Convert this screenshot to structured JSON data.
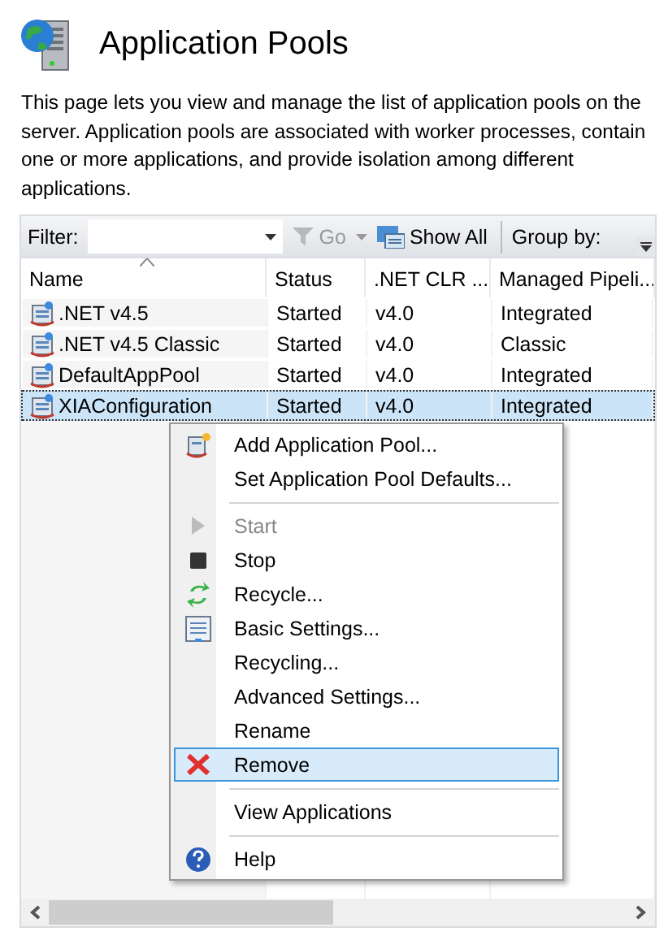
{
  "header": {
    "title": "Application Pools",
    "description": "This page lets you view and manage the list of application pools on the server. Application pools are associated with worker processes, contain one or more applications, and provide isolation among different applications."
  },
  "toolbar": {
    "filter_label": "Filter:",
    "go": {
      "label": "Go",
      "disabled": true
    },
    "show_all": "Show All",
    "group_by": "Group by:"
  },
  "table": {
    "columns": [
      {
        "label": "Name",
        "sorted": true
      },
      {
        "label": "Status",
        "sorted": false
      },
      {
        "label": ".NET CLR ...",
        "sorted": false
      },
      {
        "label": "Managed Pipeli...",
        "sorted": false
      }
    ],
    "rows": [
      {
        "cells": [
          ".NET v4.5",
          "Started",
          "v4.0",
          "Integrated"
        ],
        "selected": false
      },
      {
        "cells": [
          ".NET v4.5 Classic",
          "Started",
          "v4.0",
          "Classic"
        ],
        "selected": false
      },
      {
        "cells": [
          "DefaultAppPool",
          "Started",
          "v4.0",
          "Integrated"
        ],
        "selected": false
      },
      {
        "cells": [
          "XIAConfiguration",
          "Started",
          "v4.0",
          "Integrated"
        ],
        "selected": true
      }
    ]
  },
  "context_menu": {
    "items": [
      {
        "kind": "item",
        "label": "Add Application Pool...",
        "disabled": false,
        "selected": false
      },
      {
        "kind": "item",
        "label": "Set Application Pool Defaults...",
        "disabled": false,
        "selected": false
      },
      {
        "kind": "separator"
      },
      {
        "kind": "item",
        "label": "Start",
        "disabled": true,
        "selected": false
      },
      {
        "kind": "item",
        "label": "Stop",
        "disabled": false,
        "selected": false
      },
      {
        "kind": "item",
        "label": "Recycle...",
        "disabled": false,
        "selected": false
      },
      {
        "kind": "item",
        "label": "Basic Settings...",
        "disabled": false,
        "selected": false
      },
      {
        "kind": "item",
        "label": "Recycling...",
        "disabled": false,
        "selected": false
      },
      {
        "kind": "item",
        "label": "Advanced Settings...",
        "disabled": false,
        "selected": false
      },
      {
        "kind": "item",
        "label": "Rename",
        "disabled": false,
        "selected": false
      },
      {
        "kind": "item",
        "label": "Remove",
        "disabled": false,
        "selected": true
      },
      {
        "kind": "separator"
      },
      {
        "kind": "item",
        "label": "View Applications",
        "disabled": false,
        "selected": false
      },
      {
        "kind": "separator"
      },
      {
        "kind": "item",
        "label": "Help",
        "disabled": false,
        "selected": false
      }
    ]
  }
}
